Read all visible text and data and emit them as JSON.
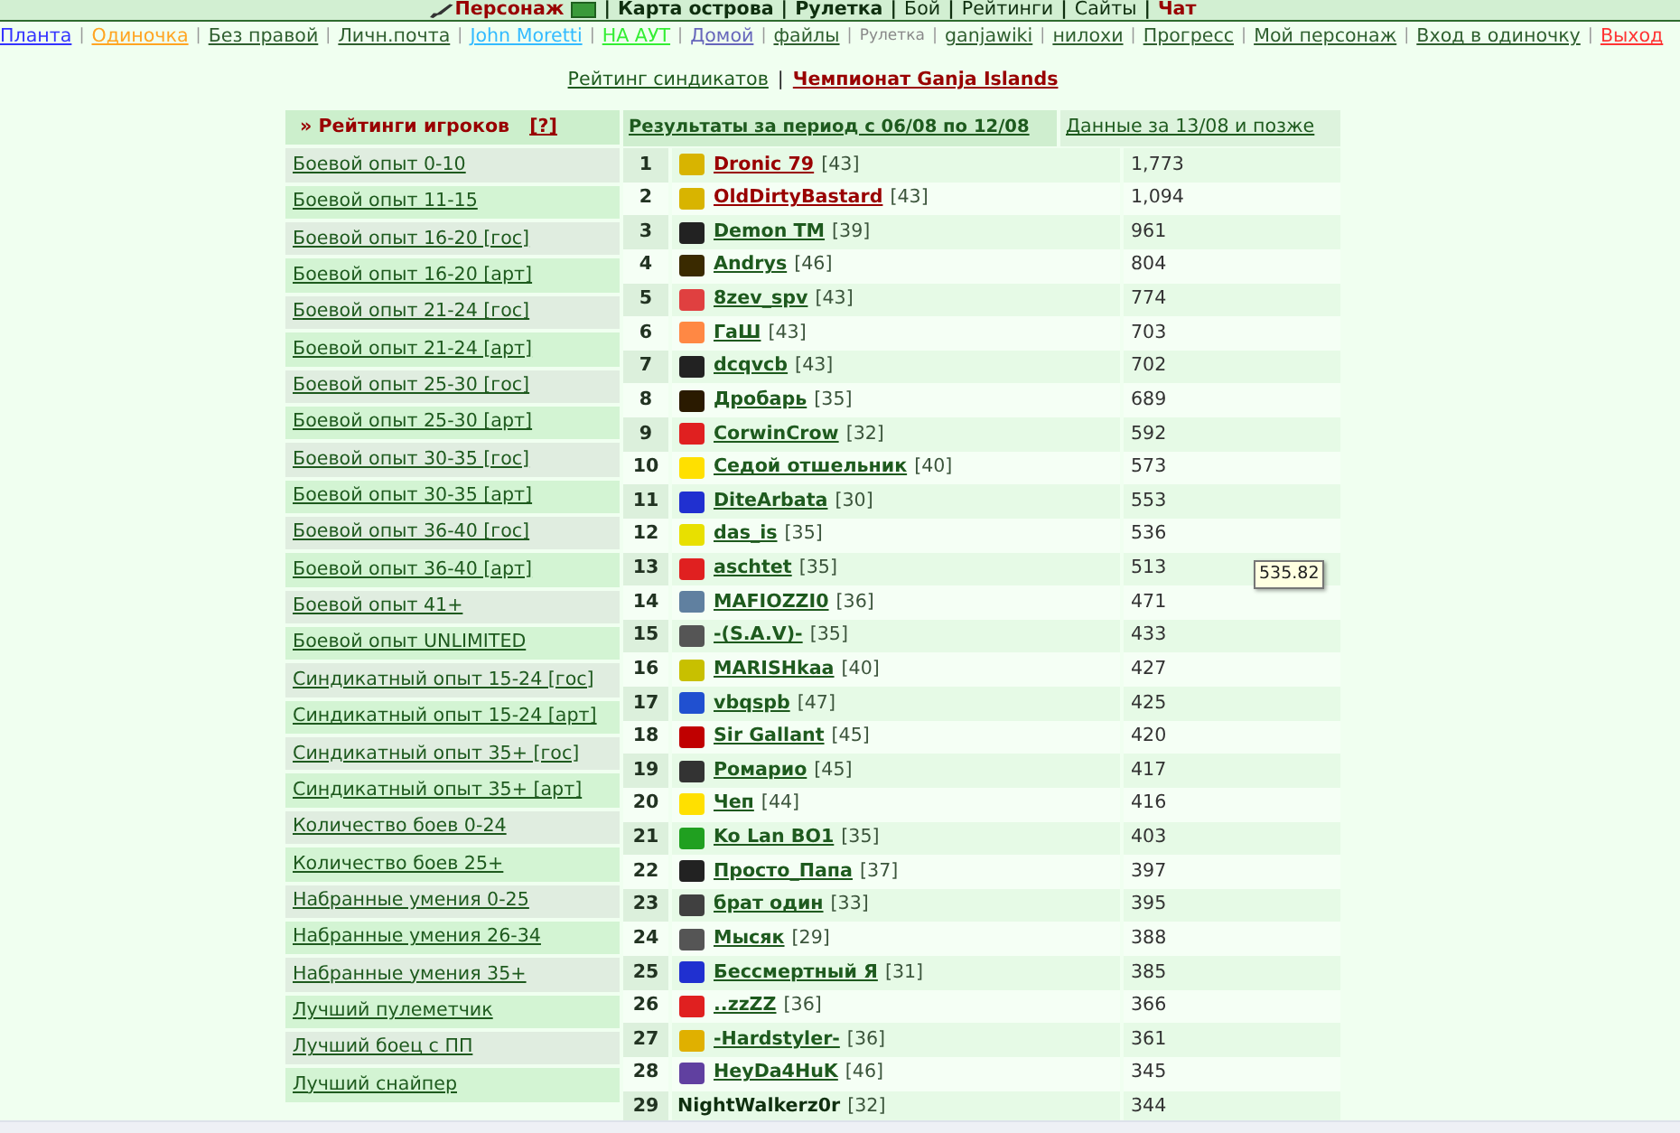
{
  "top_bar": {
    "separator": "|",
    "items": [
      {
        "label": "Персонаж",
        "kind": "character",
        "bold": true,
        "color": "#990000"
      },
      {
        "label": "Карта острова",
        "kind": "link",
        "bold": true,
        "color": "#0f2f0f"
      },
      {
        "label": "Рулетка",
        "kind": "link",
        "bold": true,
        "color": "#0f2f0f"
      },
      {
        "label": "Бой",
        "kind": "link",
        "bold": false,
        "color": "#0f2f0f"
      },
      {
        "label": "Рейтинги",
        "kind": "link",
        "bold": false,
        "color": "#0f2f0f"
      },
      {
        "label": "Сайты",
        "kind": "link",
        "bold": false,
        "color": "#0f2f0f"
      },
      {
        "label": "Чат",
        "kind": "link",
        "bold": true,
        "color": "#990000"
      }
    ]
  },
  "nav": {
    "separator": "|",
    "items": [
      {
        "label": "Планта",
        "kind": "link",
        "color": "#3333ff"
      },
      {
        "label": "Одиночка",
        "kind": "link",
        "color": "#ffa522"
      },
      {
        "label": "Без правой",
        "kind": "link",
        "color": "#2f5f2f"
      },
      {
        "label": "Личн.почта",
        "kind": "link",
        "color": "#2f5f2f"
      },
      {
        "label": "John Moretti",
        "kind": "link",
        "color": "#33bbff"
      },
      {
        "label": "НА АУТ",
        "kind": "link",
        "color": "#33ee33"
      },
      {
        "label": "Домой",
        "kind": "link",
        "color": "#6666bb"
      },
      {
        "label": "файлы",
        "kind": "link",
        "color": "#2f5f2f"
      },
      {
        "label": "Рулетка",
        "kind": "text",
        "color": "#888888"
      },
      {
        "label": "ganjawiki",
        "kind": "link",
        "color": "#2f5f2f"
      },
      {
        "label": "нилохи",
        "kind": "link",
        "color": "#2f5f2f"
      },
      {
        "label": "Прогресс",
        "kind": "link",
        "color": "#2f5f2f"
      },
      {
        "label": "Мой персонаж",
        "kind": "link",
        "color": "#2f5f2f"
      },
      {
        "label": "Вход в одиночку",
        "kind": "link",
        "color": "#2f5f2f"
      },
      {
        "label": "Выход",
        "kind": "link",
        "color": "#ff3333"
      }
    ]
  },
  "subnav": {
    "separator": "|",
    "items": [
      {
        "label": "Рейтинг синдикатов",
        "selected": false
      },
      {
        "label": "Чемпионат Ganja Islands",
        "selected": true
      }
    ]
  },
  "sidebar": {
    "title": "» Рейтинги игроков",
    "help": "[?]",
    "items": [
      "Боевой опыт 0-10",
      "Боевой опыт 11-15",
      "Боевой опыт 16-20 [гос]",
      "Боевой опыт 16-20 [арт]",
      "Боевой опыт 21-24 [гос]",
      "Боевой опыт 21-24 [арт]",
      "Боевой опыт 25-30 [гос]",
      "Боевой опыт 25-30 [арт]",
      "Боевой опыт 30-35 [гос]",
      "Боевой опыт 30-35 [арт]",
      "Боевой опыт 36-40 [гос]",
      "Боевой опыт 36-40 [арт]",
      "Боевой опыт 41+",
      "Боевой опыт UNLIMITED",
      "Синдикатный опыт 15-24 [гос]",
      "Синдикатный опыт 15-24 [арт]",
      "Синдикатный опыт 35+ [гос]",
      "Синдикатный опыт 35+ [арт]",
      "Количество боев 0-24",
      "Количество боев 25+",
      "Набранные умения 0-25",
      "Набранные умения 26-34",
      "Набранные умения 35+",
      "Лучший пулеметчик",
      "Лучший боец с ПП",
      "Лучший снайпер"
    ]
  },
  "table": {
    "columns": [
      {
        "label": "Результаты за период с 06/08 по 12/08",
        "selected": true
      },
      {
        "label": "Данные за 13/08 и позже",
        "selected": false
      }
    ],
    "rows": [
      {
        "rank": "1",
        "name": "Dronic 79",
        "level": "[43]",
        "score": "1,773",
        "kind": "highlighted",
        "color": "#d8b400"
      },
      {
        "rank": "2",
        "name": "OldDirtyBastard",
        "level": "[43]",
        "score": "1,094",
        "kind": "highlighted",
        "color": "#d8b400"
      },
      {
        "rank": "3",
        "name": "Demon TM",
        "level": "[39]",
        "score": "961",
        "kind": "player",
        "color": "#222222"
      },
      {
        "rank": "4",
        "name": "Andrys",
        "level": "[46]",
        "score": "804",
        "kind": "player",
        "color": "#3a2a00"
      },
      {
        "rank": "5",
        "name": "8zev_spv",
        "level": "[43]",
        "score": "774",
        "kind": "player",
        "color": "#e04040"
      },
      {
        "rank": "6",
        "name": "ГаШ",
        "level": "[43]",
        "score": "703",
        "kind": "player",
        "color": "#ff8844"
      },
      {
        "rank": "7",
        "name": "dcqvcb",
        "level": "[43]",
        "score": "702",
        "kind": "player",
        "color": "#222222"
      },
      {
        "rank": "8",
        "name": "Дробарь",
        "level": "[35]",
        "score": "689",
        "kind": "player",
        "color": "#2a1a00"
      },
      {
        "rank": "9",
        "name": "CorwinCrow",
        "level": "[32]",
        "score": "592",
        "kind": "player",
        "color": "#e02020"
      },
      {
        "rank": "10",
        "name": "Седой отшельник",
        "level": "[40]",
        "score": "573",
        "kind": "player",
        "color": "#ffe000"
      },
      {
        "rank": "11",
        "name": "DiteArbata",
        "level": "[30]",
        "score": "553",
        "kind": "player",
        "color": "#2030d0"
      },
      {
        "rank": "12",
        "name": "das_is",
        "level": "[35]",
        "score": "536",
        "kind": "player",
        "color": "#e8e000"
      },
      {
        "rank": "13",
        "name": "aschtet",
        "level": "[35]",
        "score": "513",
        "kind": "player",
        "color": "#e02020"
      },
      {
        "rank": "14",
        "name": "MAFIOZZI0",
        "level": "[36]",
        "score": "471",
        "kind": "player",
        "color": "#6080a0"
      },
      {
        "rank": "15",
        "name": "-(S.A.V)-",
        "level": "[35]",
        "score": "433",
        "kind": "player",
        "color": "#555555"
      },
      {
        "rank": "16",
        "name": "MARISHkaa",
        "level": "[40]",
        "score": "427",
        "kind": "player",
        "color": "#c8c000"
      },
      {
        "rank": "17",
        "name": "vbqspb",
        "level": "[47]",
        "score": "425",
        "kind": "player",
        "color": "#2050d0"
      },
      {
        "rank": "18",
        "name": "Sir Gallant",
        "level": "[45]",
        "score": "420",
        "kind": "player",
        "color": "#c00000"
      },
      {
        "rank": "19",
        "name": "Ромарио",
        "level": "[45]",
        "score": "417",
        "kind": "player",
        "color": "#333333"
      },
      {
        "rank": "20",
        "name": "Чеп",
        "level": "[44]",
        "score": "416",
        "kind": "player",
        "color": "#ffe000"
      },
      {
        "rank": "21",
        "name": "Ko Lan BO1",
        "level": "[35]",
        "score": "403",
        "kind": "player",
        "color": "#20a020"
      },
      {
        "rank": "22",
        "name": "Просто_Папа",
        "level": "[37]",
        "score": "397",
        "kind": "player",
        "color": "#222222"
      },
      {
        "rank": "23",
        "name": "брат один",
        "level": "[33]",
        "score": "395",
        "kind": "player",
        "color": "#404040"
      },
      {
        "rank": "24",
        "name": "Мысяк",
        "level": "[29]",
        "score": "388",
        "kind": "player",
        "color": "#555555"
      },
      {
        "rank": "25",
        "name": "Бессмертный Я",
        "level": "[31]",
        "score": "385",
        "kind": "player",
        "color": "#2030d0"
      },
      {
        "rank": "26",
        "name": "..zzZZ",
        "level": "[36]",
        "score": "366",
        "kind": "player",
        "color": "#e02020"
      },
      {
        "rank": "27",
        "name": "-Hardstyler-",
        "level": "[36]",
        "score": "361",
        "kind": "player",
        "color": "#e0b000"
      },
      {
        "rank": "28",
        "name": "HeyDa4HuK",
        "level": "[46]",
        "score": "345",
        "kind": "player",
        "color": "#6040a0"
      },
      {
        "rank": "29",
        "name": "NightWalkerz0r",
        "level": "[32]",
        "score": "344",
        "kind": "plain"
      }
    ]
  },
  "tooltip": "535.82"
}
